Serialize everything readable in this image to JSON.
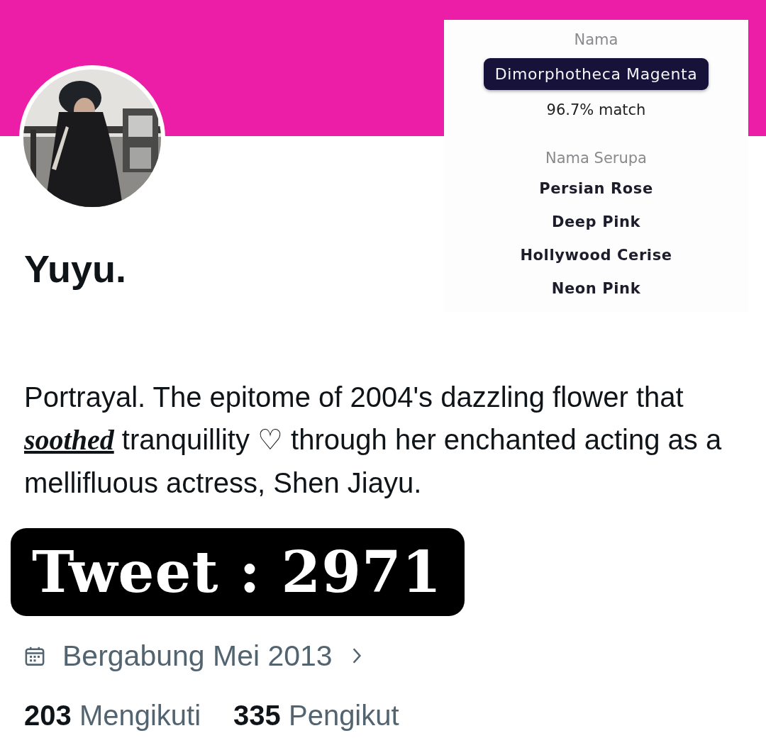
{
  "color_match": {
    "heading": "Nama",
    "name": "Dimorphotheca Magenta",
    "match": "96.7% match",
    "similar_heading": "Nama Serupa",
    "similar": [
      "Persian Rose",
      "Deep Pink",
      "Hollywood Cerise",
      "Neon Pink"
    ]
  },
  "profile": {
    "name": "Yuyu.",
    "bio": "Portrayal. The epitome of 2004's dazzling flower that *soothed* tranquillity ♡ through her enchanted acting as a mellifluous actress, Shen Jiayu.",
    "joined": "Bergabung Mei 2013",
    "stats": [
      {
        "count": "203",
        "label": "Mengikuti"
      },
      {
        "count": "335",
        "label": "Pengikut"
      }
    ]
  },
  "overlay_label": "Tweet : 2971"
}
